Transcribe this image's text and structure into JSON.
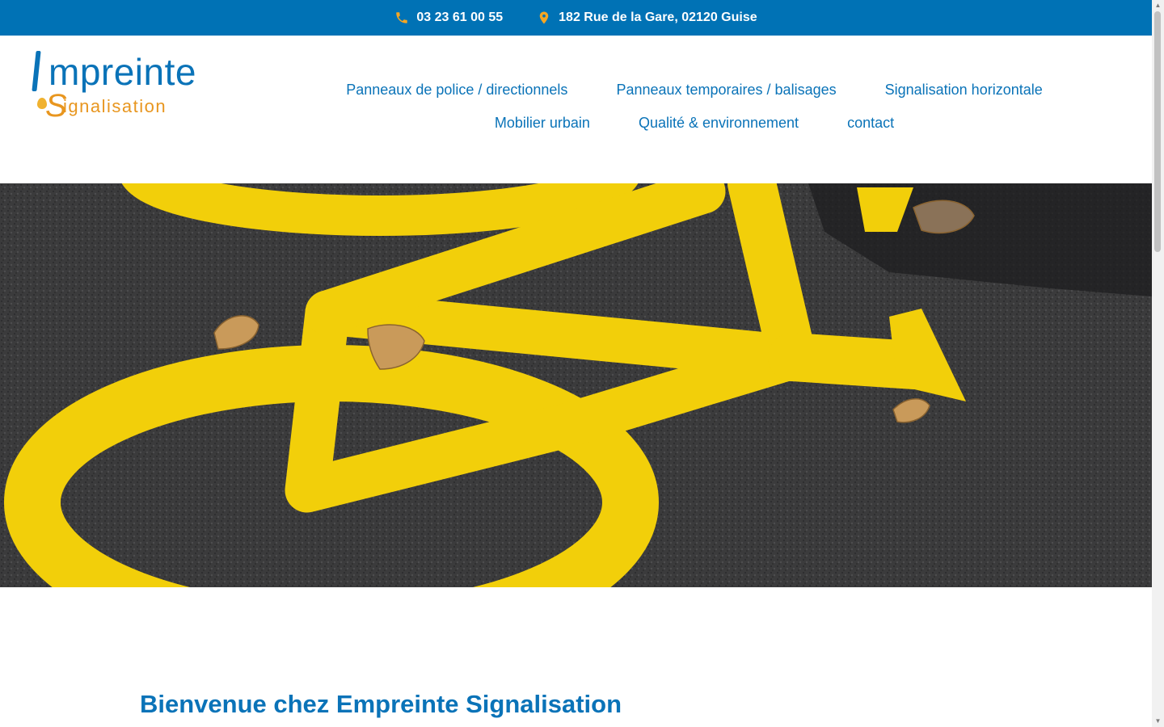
{
  "topbar": {
    "phone": "03 23 61 00 55",
    "address": "182 Rue de la Gare, 02120 Guise",
    "phone_icon": "phone-icon",
    "location_icon": "map-pin-icon",
    "icon_color": "#f5a623",
    "background": "#0072b5"
  },
  "logo": {
    "brand_main": "mpreinte",
    "brand_sub_initial": "S",
    "brand_sub": "ignalisation",
    "brand_color": "#0a73b8",
    "accent_color": "#e8961f"
  },
  "nav": {
    "items_row1": [
      {
        "label": "Panneaux de police / directionnels"
      },
      {
        "label": "Panneaux temporaires / balisages"
      },
      {
        "label": "Signalisation horizontale"
      }
    ],
    "items_row2": [
      {
        "label": "Mobilier urbain"
      },
      {
        "label": "Qualité & environnement"
      },
      {
        "label": "contact"
      }
    ]
  },
  "hero": {
    "image": "yellow bicycle lane marking on asphalt with dry leaves"
  },
  "main": {
    "heading": "Bienvenue chez Empreinte Signalisation"
  }
}
